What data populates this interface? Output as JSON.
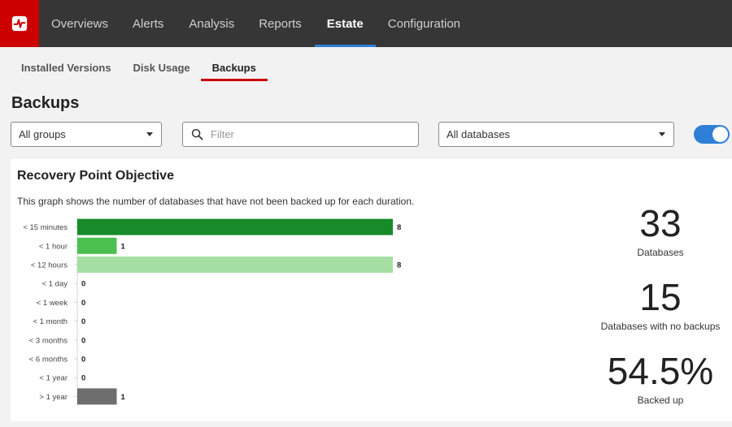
{
  "nav": {
    "items": [
      {
        "label": "Overviews",
        "active": false
      },
      {
        "label": "Alerts",
        "active": false
      },
      {
        "label": "Analysis",
        "active": false
      },
      {
        "label": "Reports",
        "active": false
      },
      {
        "label": "Estate",
        "active": true
      },
      {
        "label": "Configuration",
        "active": false
      }
    ]
  },
  "subtabs": [
    {
      "label": "Installed Versions",
      "active": false
    },
    {
      "label": "Disk Usage",
      "active": false
    },
    {
      "label": "Backups",
      "active": true
    }
  ],
  "page_title": "Backups",
  "filters": {
    "group_select": "All groups",
    "search_placeholder": "Filter",
    "database_select": "All databases",
    "toggle_on": true
  },
  "card": {
    "title": "Recovery Point Objective",
    "description": "This graph shows the number of databases that have not been backed up for each duration."
  },
  "stats": [
    {
      "value": "33",
      "label": "Databases"
    },
    {
      "value": "15",
      "label": "Databases with no backups"
    },
    {
      "value": "54.5%",
      "label": "Backed up"
    }
  ],
  "colors": {
    "accent_blue": "#2e7fd6",
    "brand_red": "#cc0000",
    "nav_bg": "#363636"
  },
  "chart_data": {
    "type": "bar",
    "orientation": "horizontal",
    "categories": [
      "< 15 minutes",
      "< 1 hour",
      "< 12 hours",
      "< 1 day",
      "< 1 week",
      "< 1 month",
      "< 3 months",
      "< 6 months",
      "< 1 year",
      "> 1 year"
    ],
    "values": [
      8,
      1,
      8,
      0,
      0,
      0,
      0,
      0,
      0,
      1
    ],
    "bar_colors": [
      "#178a2a",
      "#4cc04e",
      "#a6dfa3",
      "#a6dfa3",
      "#a6dfa3",
      "#a6dfa3",
      "#a6dfa3",
      "#a6dfa3",
      "#a6dfa3",
      "#6e6e6e"
    ],
    "xlim": [
      0,
      8
    ],
    "grid": false,
    "data_labels": true
  }
}
